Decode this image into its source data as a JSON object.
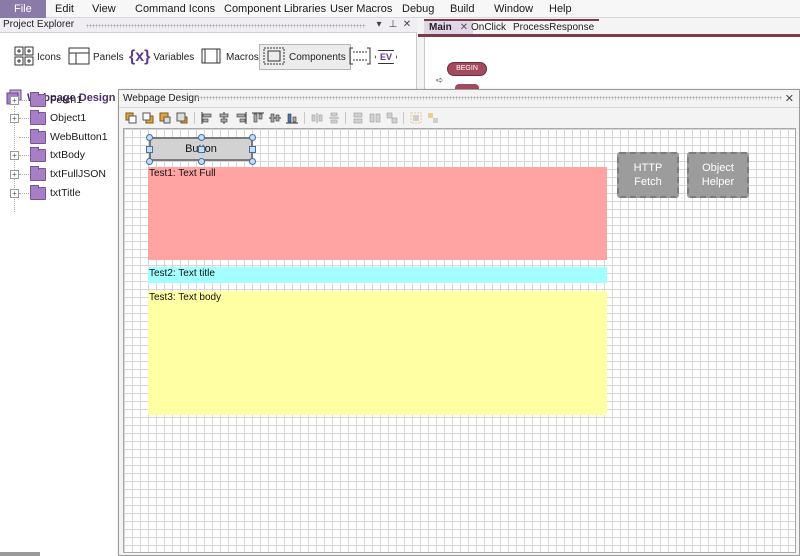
{
  "menu": [
    "File",
    "Edit",
    "View",
    "Command Icons",
    "Component Libraries",
    "User Macros",
    "Debug",
    "Build",
    "Window",
    "Help"
  ],
  "explorer": {
    "title": "Project Explorer",
    "toolbar": {
      "icons": "Icons",
      "panels": "Panels",
      "variables": "Variables",
      "variables_glyph": "{x}",
      "macros": "Macros",
      "components": "Components",
      "events_glyph": "EV"
    },
    "root": "Webpage Design",
    "items": [
      "Fetch1",
      "Object1",
      "WebButton1",
      "txtBody",
      "txtFullJSON",
      "txtTitle"
    ]
  },
  "doc_tabs": [
    {
      "label": "Main"
    },
    {
      "label": "OnClick"
    },
    {
      "label": "ProcessResponse"
    }
  ],
  "flowchart": {
    "begin": "BEGIN"
  },
  "design": {
    "title": "Webpage Design",
    "button_label": "Button",
    "text_full": "Test1:  Text Full",
    "text_title": "Test2: Text title",
    "text_body": "Test3: Text body",
    "components": [
      {
        "line1": "HTTP",
        "line2": "Fetch"
      },
      {
        "line1": "Object",
        "line2": "Helper"
      }
    ]
  },
  "colors": {
    "accent": "#8a7aa8",
    "folder": "#a77fc4",
    "tab_border": "#7a3a4a",
    "text_full_bg": "#ffa3a3",
    "text_title_bg": "#a3ffff",
    "text_body_bg": "#ffffa3",
    "component_bg": "#9c9c9c"
  }
}
